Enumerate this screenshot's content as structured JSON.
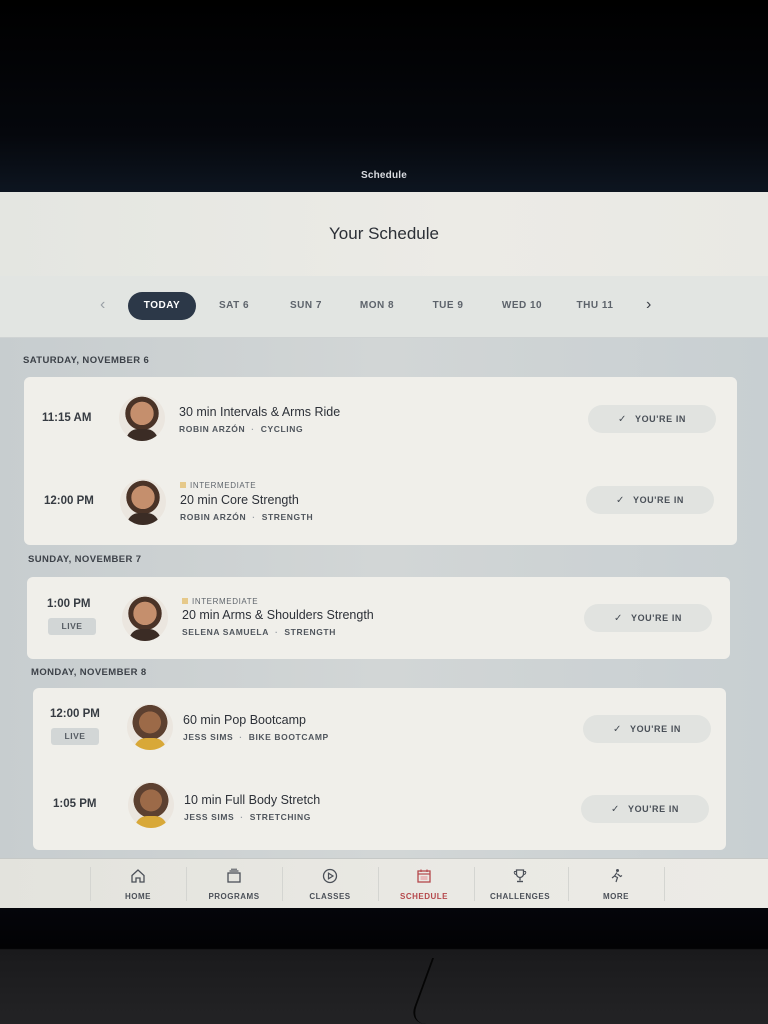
{
  "status_bar": {
    "title": "Schedule"
  },
  "header": {
    "title": "Your Schedule"
  },
  "day_nav": {
    "prev_icon": "chevron-left-icon",
    "next_icon": "chevron-right-icon",
    "tabs": [
      {
        "label": "TODAY",
        "active": true
      },
      {
        "label": "SAT 6"
      },
      {
        "label": "SUN 7"
      },
      {
        "label": "MON 8"
      },
      {
        "label": "TUE 9"
      },
      {
        "label": "WED 10"
      },
      {
        "label": "THU 11"
      }
    ]
  },
  "sections": [
    {
      "label": "SATURDAY, NOVEMBER 6",
      "classes": [
        {
          "time": "11:15 AM",
          "title": "30 min Intervals & Arms Ride",
          "instructor": "ROBIN ARZÓN",
          "category": "CYCLING",
          "status": "YOU'RE IN"
        },
        {
          "time": "12:00 PM",
          "level": "INTERMEDIATE",
          "title": "20 min Core Strength",
          "instructor": "ROBIN ARZÓN",
          "category": "STRENGTH",
          "status": "YOU'RE IN"
        }
      ]
    },
    {
      "label": "SUNDAY, NOVEMBER 7",
      "classes": [
        {
          "time": "1:00 PM",
          "live": "LIVE",
          "level": "INTERMEDIATE",
          "title": "20 min Arms & Shoulders Strength",
          "instructor": "SELENA SAMUELA",
          "category": "STRENGTH",
          "status": "YOU'RE IN"
        }
      ]
    },
    {
      "label": "MONDAY, NOVEMBER 8",
      "classes": [
        {
          "time": "12:00 PM",
          "live": "LIVE",
          "title": "60 min Pop Bootcamp",
          "instructor": "JESS SIMS",
          "category": "BIKE BOOTCAMP",
          "status": "YOU'RE IN"
        },
        {
          "time": "1:05 PM",
          "title": "10 min Full Body Stretch",
          "instructor": "JESS SIMS",
          "category": "STRETCHING",
          "status": "YOU'RE IN"
        }
      ]
    }
  ],
  "tab_bar": {
    "items": [
      {
        "label": "HOME",
        "icon": "home-icon"
      },
      {
        "label": "PROGRAMS",
        "icon": "programs-icon"
      },
      {
        "label": "CLASSES",
        "icon": "play-circle-icon"
      },
      {
        "label": "SCHEDULE",
        "icon": "calendar-icon",
        "active": true
      },
      {
        "label": "CHALLENGES",
        "icon": "trophy-icon"
      },
      {
        "label": "MORE",
        "icon": "person-activity-icon"
      }
    ]
  },
  "colors": {
    "accent_active_tab": "#b5484c",
    "today_pill": "#2c3848",
    "intermediate_dot": "#e6c98a"
  }
}
